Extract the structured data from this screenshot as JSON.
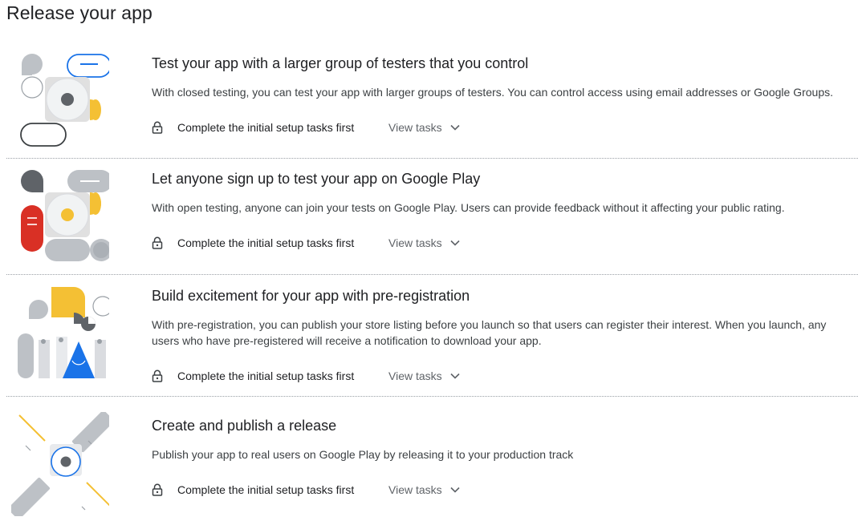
{
  "page": {
    "title": "Release your app"
  },
  "sections": [
    {
      "title": "Test your app with a larger group of testers that you control",
      "description": "With closed testing, you can test your app with larger groups of testers. You can control access using email addresses or Google Groups.",
      "status": "Complete the initial setup tasks first",
      "action": "View tasks"
    },
    {
      "title": "Let anyone sign up to test your app on Google Play",
      "description": "With open testing, anyone can join your tests on Google Play. Users can provide feedback without it affecting your public rating.",
      "status": "Complete the initial setup tasks first",
      "action": "View tasks"
    },
    {
      "title": "Build excitement for your app with pre-registration",
      "description": "With pre-registration, you can publish your store listing before you launch so that users can register their interest. When you launch, any users who have pre-registered will receive a notification to download your app.",
      "status": "Complete the initial setup tasks first",
      "action": "View tasks"
    },
    {
      "title": "Create and publish a release",
      "description": "Publish your app to real users on Google Play by releasing it to your production track",
      "status": "Complete the initial setup tasks first",
      "action": "View tasks"
    }
  ],
  "icons": {
    "lock": "lock-icon",
    "chevron": "chevron-down-icon"
  },
  "colors": {
    "yellow": "#f4c034",
    "blue": "#1a73e8",
    "red": "#d93025",
    "dark_gray": "#5f6368",
    "light_gray": "#dadce0"
  }
}
